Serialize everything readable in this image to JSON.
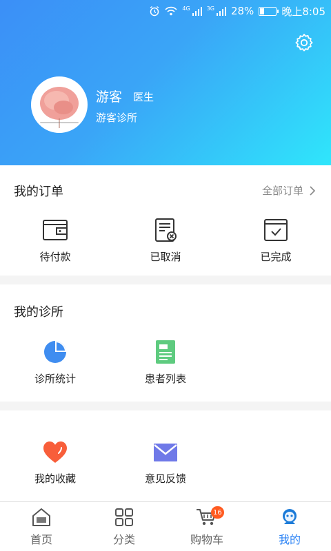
{
  "status_bar": {
    "network_4g": "4G",
    "network_3g": "3G",
    "battery": "28%",
    "battery_level": 0.28,
    "time": "晚上8:05"
  },
  "profile": {
    "name": "游客",
    "role": "医生",
    "clinic": "游客诊所"
  },
  "orders": {
    "title": "我的订单",
    "all_link": "全部订单",
    "items": [
      {
        "label": "待付款",
        "icon": "wallet-icon"
      },
      {
        "label": "已取消",
        "icon": "cancelled-document-icon"
      },
      {
        "label": "已完成",
        "icon": "completed-check-icon"
      }
    ]
  },
  "clinic_section": {
    "title": "我的诊所",
    "items": [
      {
        "label": "诊所统计",
        "icon": "pie-chart-icon"
      },
      {
        "label": "患者列表",
        "icon": "patient-list-icon"
      }
    ]
  },
  "misc": {
    "items": [
      {
        "label": "我的收藏",
        "icon": "heart-icon"
      },
      {
        "label": "意见反馈",
        "icon": "mail-icon"
      }
    ]
  },
  "tabbar": {
    "tabs": [
      {
        "label": "首页",
        "icon": "home-icon"
      },
      {
        "label": "分类",
        "icon": "grid-icon"
      },
      {
        "label": "购物车",
        "icon": "cart-icon",
        "badge": "16"
      },
      {
        "label": "我的",
        "icon": "profile-robot-icon",
        "active": true
      }
    ]
  },
  "colors": {
    "header_start": "#3b8ff7",
    "header_end": "#2fe6fb",
    "accent": "#2a82f5",
    "badge": "#ff5a20"
  }
}
